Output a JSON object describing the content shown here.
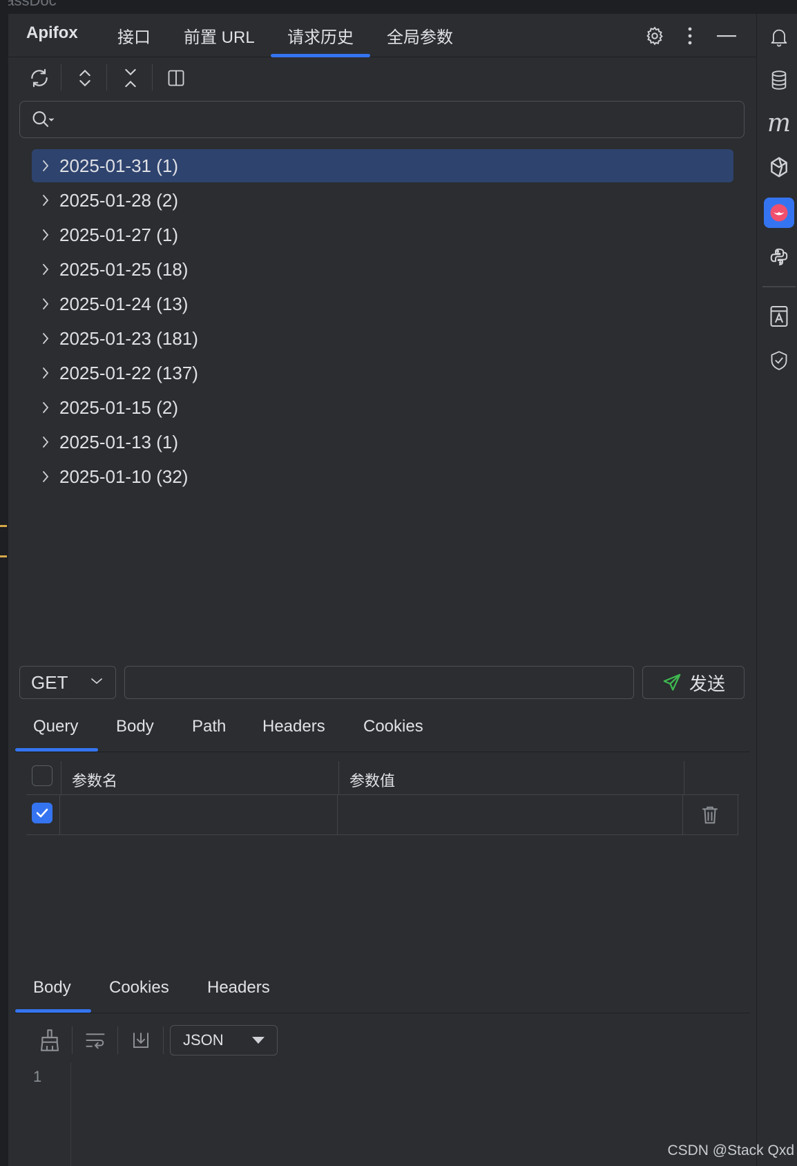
{
  "window": {
    "partial_title": "uassDoc"
  },
  "header": {
    "brand": "Apifox",
    "tabs": [
      {
        "label": "接口"
      },
      {
        "label": "前置 URL"
      },
      {
        "label": "请求历史",
        "active": true
      },
      {
        "label": "全局参数"
      }
    ],
    "icons": [
      "gear-icon",
      "more-vertical-icon",
      "minimize-icon"
    ]
  },
  "toolbar": {
    "icons": [
      "refresh-icon",
      "expand-all-icon",
      "collapse-all-icon",
      "split-view-icon"
    ]
  },
  "search": {
    "placeholder": "",
    "value": ""
  },
  "history": [
    {
      "label": "2025-01-31 (1)",
      "selected": true
    },
    {
      "label": "2025-01-28 (2)"
    },
    {
      "label": "2025-01-27 (1)"
    },
    {
      "label": "2025-01-25 (18)"
    },
    {
      "label": "2025-01-24 (13)"
    },
    {
      "label": "2025-01-23 (181)"
    },
    {
      "label": "2025-01-22 (137)"
    },
    {
      "label": "2025-01-15 (2)"
    },
    {
      "label": "2025-01-13 (1)"
    },
    {
      "label": "2025-01-10 (32)"
    }
  ],
  "request": {
    "method": "GET",
    "url": "",
    "send_label": "发送",
    "tabs": [
      {
        "label": "Query",
        "active": true
      },
      {
        "label": "Body"
      },
      {
        "label": "Path"
      },
      {
        "label": "Headers"
      },
      {
        "label": "Cookies"
      }
    ],
    "params_table": {
      "columns": [
        "参数名",
        "参数值"
      ],
      "rows": [
        {
          "checked": true,
          "name": "",
          "value": ""
        }
      ]
    }
  },
  "response": {
    "tabs": [
      {
        "label": "Body",
        "active": true
      },
      {
        "label": "Cookies"
      },
      {
        "label": "Headers"
      }
    ],
    "format": "JSON",
    "line_numbers": [
      "1"
    ]
  },
  "right_sidebar": {
    "icons": [
      "bell-icon",
      "database-icon",
      "m-plugin-icon",
      "ai-assistant-icon",
      "apifox-icon",
      "python-icon",
      "docs-icon",
      "shield-check-icon"
    ],
    "m_glyph": "m"
  },
  "colors": {
    "accent": "#3574f0",
    "selected_row": "#2e436e",
    "send_icon": "#3fb950",
    "apifox_brand": "#f0506e"
  },
  "watermark": "CSDN @Stack Qxd"
}
